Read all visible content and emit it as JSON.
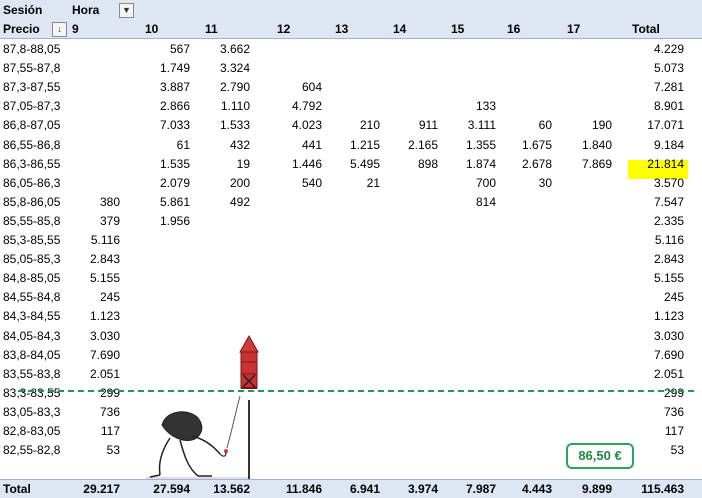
{
  "pivot": {
    "filter_label": "Sesión",
    "column_field_label": "Hora",
    "row_field_label": "Precio",
    "columns": [
      "9",
      "10",
      "11",
      "12",
      "13",
      "14",
      "15",
      "16",
      "17"
    ],
    "total_label": "Total",
    "rows": [
      {
        "label": "87,8-88,05",
        "values": [
          "",
          "567",
          "3.662",
          "",
          "",
          "",
          "",
          "",
          ""
        ],
        "total": "4.229"
      },
      {
        "label": "87,55-87,8",
        "values": [
          "",
          "1.749",
          "3.324",
          "",
          "",
          "",
          "",
          "",
          ""
        ],
        "total": "5.073"
      },
      {
        "label": "87,3-87,55",
        "values": [
          "",
          "3.887",
          "2.790",
          "604",
          "",
          "",
          "",
          "",
          ""
        ],
        "total": "7.281"
      },
      {
        "label": "87,05-87,3",
        "values": [
          "",
          "2.866",
          "1.110",
          "4.792",
          "",
          "",
          "133",
          "",
          ""
        ],
        "total": "8.901"
      },
      {
        "label": "86,8-87,05",
        "values": [
          "",
          "7.033",
          "1.533",
          "4.023",
          "210",
          "911",
          "3.111",
          "60",
          "190"
        ],
        "total": "17.071"
      },
      {
        "label": "86,55-86,8",
        "values": [
          "",
          "61",
          "432",
          "441",
          "1.215",
          "2.165",
          "1.355",
          "1.675",
          "1.840"
        ],
        "total": "9.184"
      },
      {
        "label": "86,3-86,55",
        "values": [
          "",
          "1.535",
          "19",
          "1.446",
          "5.495",
          "898",
          "1.874",
          "2.678",
          "7.869"
        ],
        "total": "21.814"
      },
      {
        "label": "86,05-86,3",
        "values": [
          "",
          "2.079",
          "200",
          "540",
          "21",
          "",
          "700",
          "30",
          ""
        ],
        "total": "3.570"
      },
      {
        "label": "85,8-86,05",
        "values": [
          "380",
          "5.861",
          "492",
          "",
          "",
          "",
          "814",
          "",
          ""
        ],
        "total": "7.547"
      },
      {
        "label": "85,55-85,8",
        "values": [
          "379",
          "1.956",
          "",
          "",
          "",
          "",
          "",
          "",
          ""
        ],
        "total": "2.335"
      },
      {
        "label": "85,3-85,55",
        "values": [
          "5.116",
          "",
          "",
          "",
          "",
          "",
          "",
          "",
          ""
        ],
        "total": "5.116"
      },
      {
        "label": "85,05-85,3",
        "values": [
          "2.843",
          "",
          "",
          "",
          "",
          "",
          "",
          "",
          ""
        ],
        "total": "2.843"
      },
      {
        "label": "84,8-85,05",
        "values": [
          "5.155",
          "",
          "",
          "",
          "",
          "",
          "",
          "",
          ""
        ],
        "total": "5.155"
      },
      {
        "label": "84,55-84,8",
        "values": [
          "245",
          "",
          "",
          "",
          "",
          "",
          "",
          "",
          ""
        ],
        "total": "245"
      },
      {
        "label": "84,3-84,55",
        "values": [
          "1.123",
          "",
          "",
          "",
          "",
          "",
          "",
          "",
          ""
        ],
        "total": "1.123"
      },
      {
        "label": "84,05-84,3",
        "values": [
          "3.030",
          "",
          "",
          "",
          "",
          "",
          "",
          "",
          ""
        ],
        "total": "3.030"
      },
      {
        "label": "83,8-84,05",
        "values": [
          "7.690",
          "",
          "",
          "",
          "",
          "",
          "",
          "",
          ""
        ],
        "total": "7.690"
      },
      {
        "label": "83,55-83,8",
        "values": [
          "2.051",
          "",
          "",
          "",
          "",
          "",
          "",
          "",
          ""
        ],
        "total": "2.051"
      },
      {
        "label": "83,3-83,55",
        "values": [
          "299",
          "",
          "",
          "",
          "",
          "",
          "",
          "",
          ""
        ],
        "total": "299"
      },
      {
        "label": "83,05-83,3",
        "values": [
          "736",
          "",
          "",
          "",
          "",
          "",
          "",
          "",
          ""
        ],
        "total": "736"
      },
      {
        "label": "82,8-83,05",
        "values": [
          "117",
          "",
          "",
          "",
          "",
          "",
          "",
          "",
          ""
        ],
        "total": "117"
      },
      {
        "label": "82,55-82,8",
        "values": [
          "53",
          "",
          "",
          "",
          "",
          "",
          "",
          "",
          ""
        ],
        "total": "53"
      }
    ],
    "grand_total": {
      "label": "Total",
      "values": [
        "29.217",
        "27.594",
        "13.562",
        "11.846",
        "6.941",
        "3.974",
        "7.987",
        "4.443",
        "9.899"
      ],
      "total": "115.463"
    }
  },
  "price_badge": "86,50 €",
  "highlight_color": "#ffff00",
  "support_line_color": "#1f9a55",
  "icons": {
    "filter_dropdown": "chevron-down-icon",
    "sort_filter": "sort-filter-icon"
  }
}
